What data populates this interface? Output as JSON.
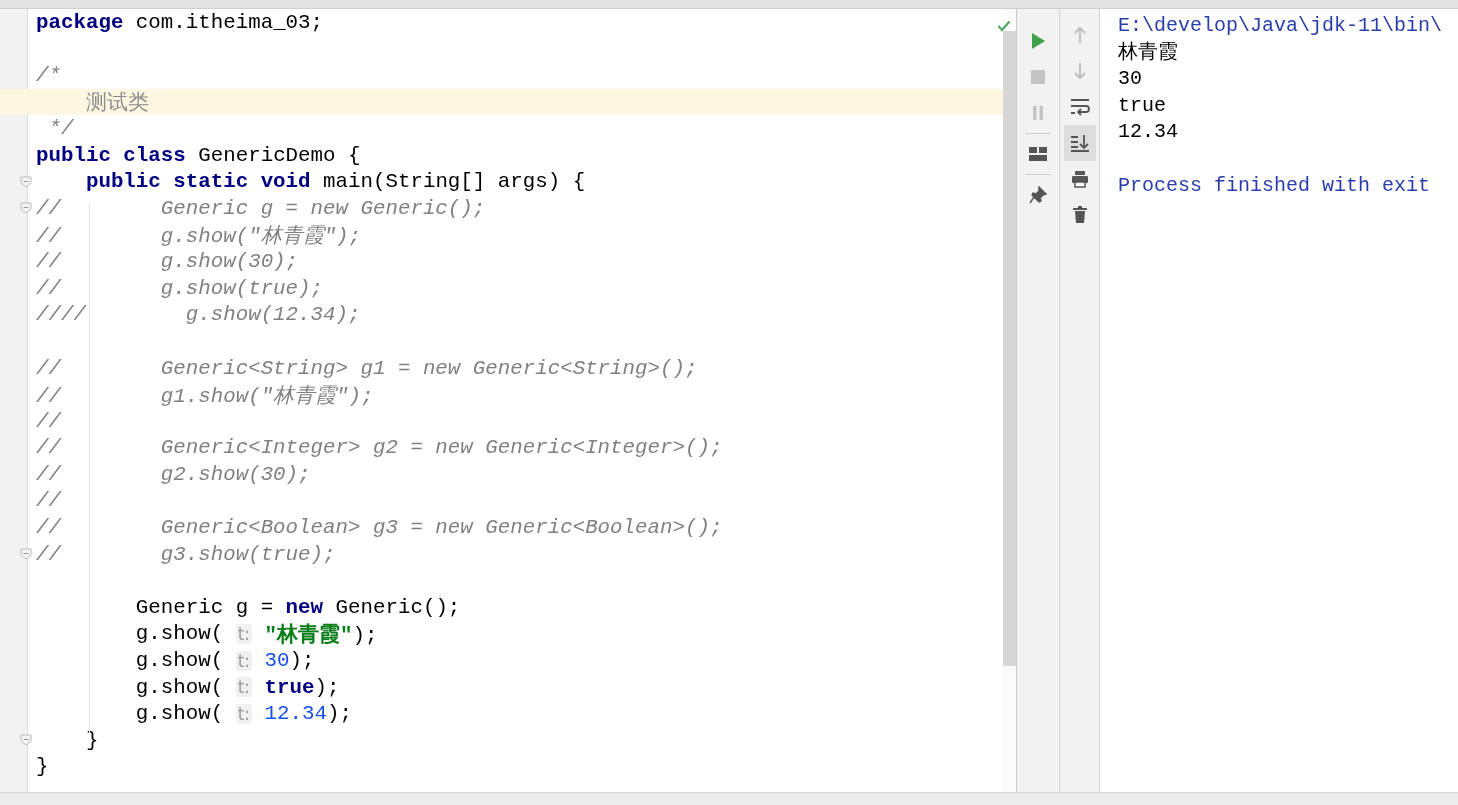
{
  "editor": {
    "code_lines": [
      {
        "current": false,
        "fold": false,
        "segments": [
          {
            "kind": "kw",
            "text": "package"
          },
          {
            "kind": "plain",
            "text": " com.itheima_03;"
          }
        ]
      },
      {
        "current": false,
        "fold": false
      },
      {
        "current": false,
        "fold": false,
        "segments": [
          {
            "kind": "comment",
            "text": "/*"
          }
        ]
      },
      {
        "current": true,
        "fold": false,
        "segments": [
          {
            "kind": "doc",
            "text": "    测试类"
          }
        ]
      },
      {
        "current": false,
        "fold": false,
        "segments": [
          {
            "kind": "comment",
            "text": " */"
          }
        ]
      },
      {
        "current": false,
        "fold": false,
        "segments": [
          {
            "kind": "kw",
            "text": "public class"
          },
          {
            "kind": "plain",
            "text": " GenericDemo {"
          }
        ]
      },
      {
        "current": false,
        "fold": true,
        "segments": [
          {
            "kind": "kw",
            "text": "    public static void"
          },
          {
            "kind": "plain",
            "text": " main(String[] args) {"
          }
        ]
      },
      {
        "current": false,
        "fold": true,
        "segments": [
          {
            "kind": "comment",
            "text": "//        Generic g = new Generic();"
          }
        ]
      },
      {
        "current": false,
        "fold": false,
        "segments": [
          {
            "kind": "comment",
            "text": "//        g.show(\"林青霞\");"
          }
        ]
      },
      {
        "current": false,
        "fold": false,
        "segments": [
          {
            "kind": "comment",
            "text": "//        g.show(30);"
          }
        ]
      },
      {
        "current": false,
        "fold": false,
        "segments": [
          {
            "kind": "comment",
            "text": "//        g.show(true);"
          }
        ]
      },
      {
        "current": false,
        "fold": false,
        "segments": [
          {
            "kind": "comment",
            "text": "////        g.show(12.34);"
          }
        ]
      },
      {
        "current": false,
        "fold": false
      },
      {
        "current": false,
        "fold": false,
        "segments": [
          {
            "kind": "comment",
            "text": "//        Generic<String> g1 = new Generic<String>();"
          }
        ]
      },
      {
        "current": false,
        "fold": false,
        "segments": [
          {
            "kind": "comment",
            "text": "//        g1.show(\"林青霞\");"
          }
        ]
      },
      {
        "current": false,
        "fold": false,
        "segments": [
          {
            "kind": "comment",
            "text": "//"
          }
        ]
      },
      {
        "current": false,
        "fold": false,
        "segments": [
          {
            "kind": "comment",
            "text": "//        Generic<Integer> g2 = new Generic<Integer>();"
          }
        ]
      },
      {
        "current": false,
        "fold": false,
        "segments": [
          {
            "kind": "comment",
            "text": "//        g2.show(30);"
          }
        ]
      },
      {
        "current": false,
        "fold": false,
        "segments": [
          {
            "kind": "comment",
            "text": "//"
          }
        ]
      },
      {
        "current": false,
        "fold": false,
        "segments": [
          {
            "kind": "comment",
            "text": "//        Generic<Boolean> g3 = new Generic<Boolean>();"
          }
        ]
      },
      {
        "current": false,
        "fold": true,
        "segments": [
          {
            "kind": "comment",
            "text": "//        g3.show(true);"
          }
        ]
      },
      {
        "current": false,
        "fold": false
      },
      {
        "current": false,
        "fold": false,
        "segments": [
          {
            "kind": "plain",
            "text": "        Generic g = "
          },
          {
            "kind": "kw",
            "text": "new"
          },
          {
            "kind": "plain",
            "text": " Generic();"
          }
        ]
      },
      {
        "current": false,
        "fold": false,
        "segments": [
          {
            "kind": "plain",
            "text": "        g.show( "
          },
          {
            "kind": "hint",
            "text": "t:"
          },
          {
            "kind": "string",
            "text": " \"林青霞\""
          },
          {
            "kind": "plain",
            "text": ");"
          }
        ]
      },
      {
        "current": false,
        "fold": false,
        "segments": [
          {
            "kind": "plain",
            "text": "        g.show( "
          },
          {
            "kind": "hint",
            "text": "t:"
          },
          {
            "kind": "number",
            "text": " 30"
          },
          {
            "kind": "plain",
            "text": ");"
          }
        ]
      },
      {
        "current": false,
        "fold": false,
        "segments": [
          {
            "kind": "plain",
            "text": "        g.show( "
          },
          {
            "kind": "hint",
            "text": "t:"
          },
          {
            "kind": "kw",
            "text": " true"
          },
          {
            "kind": "plain",
            "text": ");"
          }
        ]
      },
      {
        "current": false,
        "fold": false,
        "segments": [
          {
            "kind": "plain",
            "text": "        g.show( "
          },
          {
            "kind": "hint",
            "text": "t:"
          },
          {
            "kind": "number",
            "text": " 12.34"
          },
          {
            "kind": "plain",
            "text": ");"
          }
        ]
      },
      {
        "current": false,
        "fold": true,
        "segments": [
          {
            "kind": "plain",
            "text": "    }"
          }
        ]
      },
      {
        "current": false,
        "fold": false,
        "segments": [
          {
            "kind": "plain",
            "text": "}"
          }
        ]
      }
    ]
  },
  "run_toolbar": [
    {
      "kind": "run",
      "disabled": false
    },
    {
      "kind": "stop",
      "disabled": true
    },
    {
      "kind": "pause",
      "disabled": true
    },
    {
      "kind": "separator"
    },
    {
      "kind": "layout",
      "disabled": false
    },
    {
      "kind": "separator"
    },
    {
      "kind": "pin",
      "disabled": false
    }
  ],
  "console_toolbar": [
    {
      "kind": "up",
      "selected": false
    },
    {
      "kind": "down",
      "selected": false
    },
    {
      "kind": "wrap",
      "selected": false
    },
    {
      "kind": "scroll-end",
      "selected": true
    },
    {
      "kind": "print",
      "selected": false
    },
    {
      "kind": "trash",
      "selected": false
    }
  ],
  "console": [
    {
      "kind": "system",
      "text": "E:\\develop\\Java\\jdk-11\\bin\\"
    },
    {
      "kind": "output",
      "text": "林青霞"
    },
    {
      "kind": "output",
      "text": "30"
    },
    {
      "kind": "output",
      "text": "true"
    },
    {
      "kind": "output",
      "text": "12.34"
    },
    {
      "kind": "exit",
      "text": "Process finished with exit"
    }
  ]
}
